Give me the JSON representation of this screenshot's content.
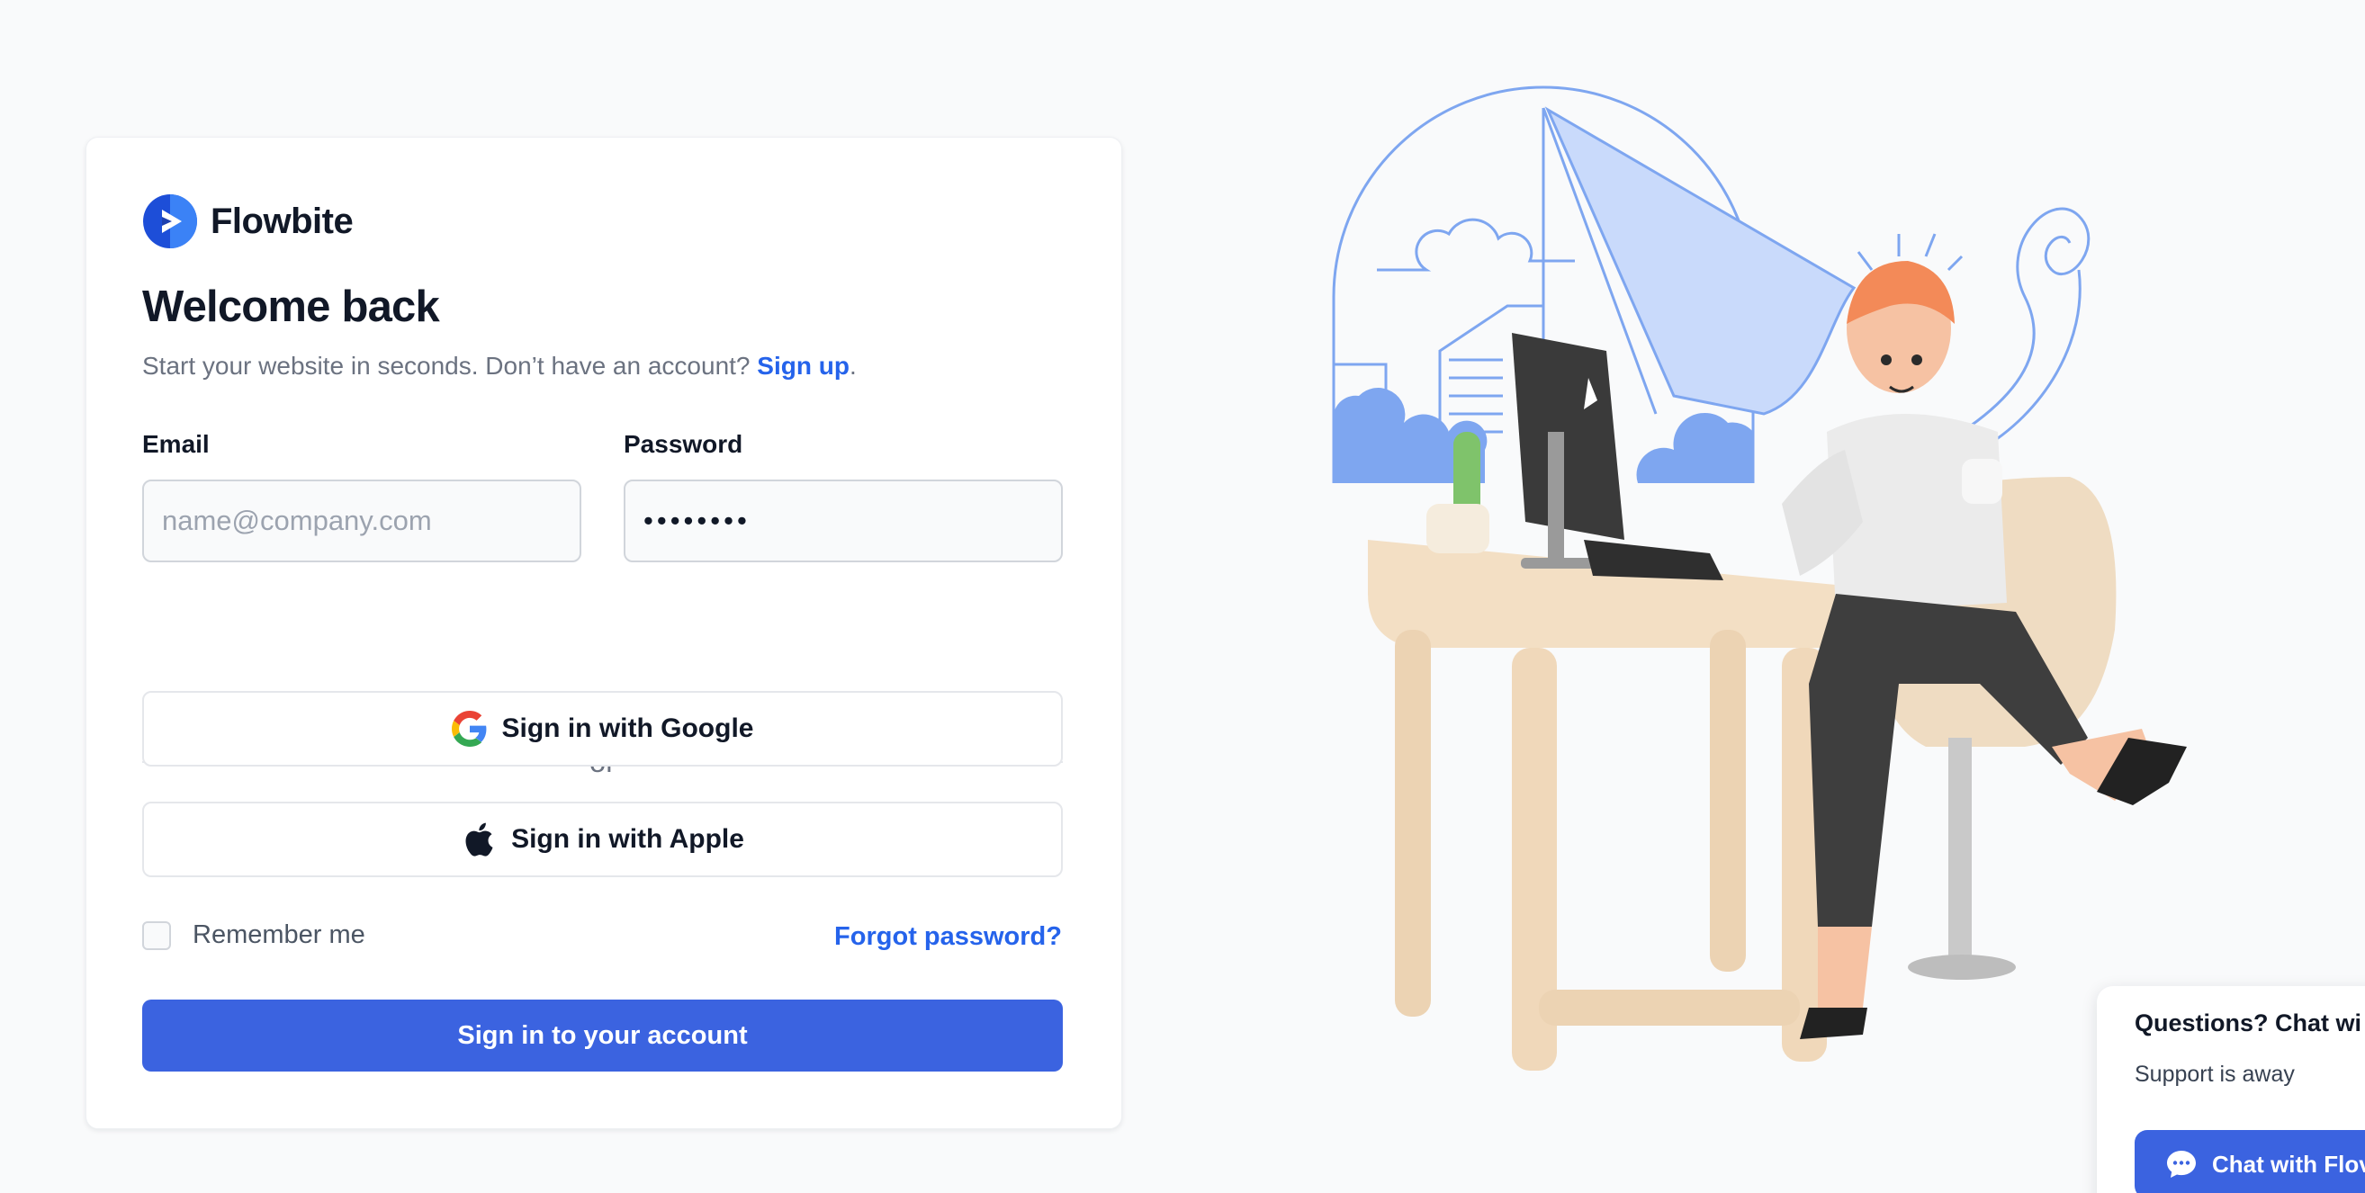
{
  "brand": {
    "name": "Flowbite",
    "logo_icon": "flowbite-logo-icon",
    "logo_color": "#1d4ed8"
  },
  "login": {
    "heading": "Welcome back",
    "subtitle_text": "Start your website in seconds. Don’t have an account?",
    "signup_link": "Sign up",
    "subtitle_end": ".",
    "email_label": "Email",
    "email_placeholder": "name@company.com",
    "email_value": "",
    "password_label": "Password",
    "password_value": "••••••••",
    "divider_text": "or",
    "google_label": "Sign in with Google",
    "google_icon": "google-icon",
    "apple_label": "Sign in with Apple",
    "apple_icon": "apple-icon",
    "remember_label": "Remember me",
    "remember_checked": false,
    "forgot_label": "Forgot password?",
    "submit_label": "Sign in to your account"
  },
  "chat_widget": {
    "title": "Questions? Chat wi",
    "status": "Support is away",
    "button_label": "Chat with Flov",
    "button_icon": "chat-bubble-icon"
  },
  "colors": {
    "primary": "#3b63e0",
    "link": "#2563eb",
    "background": "#f9fafb",
    "illustration_blue": "#7ea6f0"
  }
}
